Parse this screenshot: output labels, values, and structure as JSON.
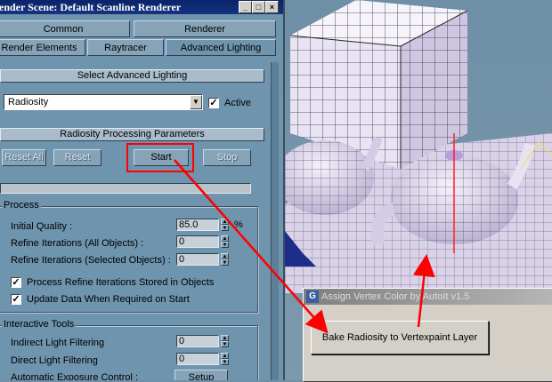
{
  "window": {
    "title": "ender Scene: Default Scanline Renderer",
    "controls": [
      "_",
      "□",
      "×"
    ]
  },
  "tabs": {
    "row1": [
      "Common",
      "Renderer"
    ],
    "row2": [
      "Render Elements",
      "Raytracer",
      "Advanced Lighting"
    ]
  },
  "select_lighting": {
    "header": "Select Advanced Lighting",
    "dropdown_value": "Radiosity",
    "active_label": "Active",
    "active_checked": true
  },
  "processing": {
    "header": "Radiosity Processing Parameters",
    "reset_all": "Reset All",
    "reset": "Reset",
    "start": "Start",
    "stop": "Stop"
  },
  "process_group": {
    "title": "Process",
    "initial_quality_label": "Initial Quality :",
    "initial_quality_value": "85.0",
    "percent": "%",
    "refine_all_label": "Refine Iterations (All Objects) :",
    "refine_all_value": "0",
    "refine_selected_label": "Refine Iterations (Selected Objects) :",
    "refine_selected_value": "0",
    "process_refine_label": "Process Refine Iterations Stored in Objects",
    "update_data_label": "Update Data When Required on Start"
  },
  "interactive_group": {
    "title": "Interactive Tools",
    "indirect_label": "Indirect Light Filtering",
    "indirect_value": "0",
    "direct_label": "Direct Light Filtering",
    "direct_value": "0",
    "exposure_label": "Automatic Exposure Control :",
    "setup_label": "Setup"
  },
  "autoit": {
    "title": "Assign Vertex Color by AutoIt v1.5",
    "button_label": "Bake Radiosity to Vertexpaint Layer"
  },
  "colors": {
    "panel_bg": "#6f94ad",
    "title_bar": "#0a246a",
    "annotation": "#ff0000"
  }
}
